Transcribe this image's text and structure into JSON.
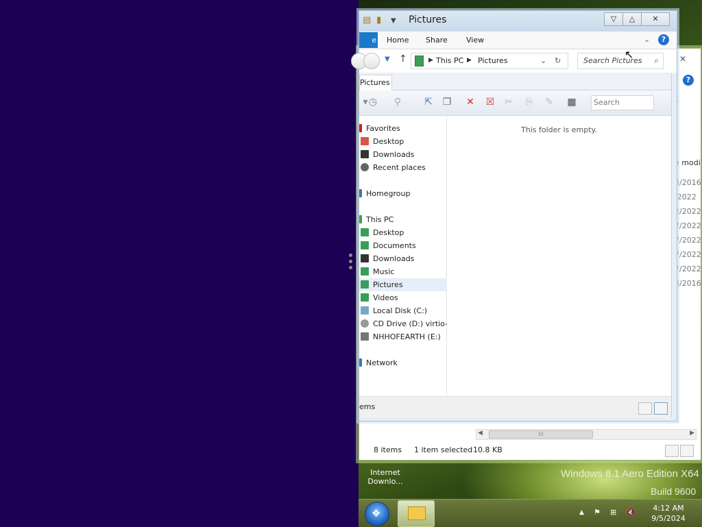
{
  "back_window": {
    "close_glyph": "✕",
    "help_glyph": "?",
    "column_header": "e modi",
    "dates": [
      "8/2016",
      "/2022",
      "2/2022",
      "7/2022",
      "7/2022",
      "7/2022",
      "7/2022",
      "8/2016"
    ],
    "status": {
      "count": "8 items",
      "selected": "1 item selected",
      "size": "10.8 KB"
    },
    "scroll_thumb_glyph": "⁞⁞⁞"
  },
  "window": {
    "title": "Pictures",
    "quick_access_icons": [
      "properties-icon",
      "new-folder-icon",
      "customize-dropdown-icon"
    ],
    "caption": {
      "minimize": "▽",
      "maximize": "△",
      "close": "✕"
    },
    "ribbon": {
      "file_tab": "e",
      "tabs": [
        "Home",
        "Share",
        "View"
      ],
      "help": "?"
    },
    "navigation": {
      "breadcrumb": [
        "This PC",
        "Pictures"
      ],
      "search_placeholder": "Search Pictures"
    },
    "tab_label": "Pictures",
    "toolbar_search_placeholder": "Search",
    "nav_pane": {
      "favorites_header": "Favorites",
      "favorites": [
        "Desktop",
        "Downloads",
        "Recent places"
      ],
      "homegroup": "Homegroup",
      "this_pc_header": "This PC",
      "this_pc": [
        "Desktop",
        "Documents",
        "Downloads",
        "Music",
        "Pictures",
        "Videos",
        "Local Disk (C:)",
        "CD Drive (D:) virtio-wi",
        "NHHOFEARTH (E:)"
      ],
      "network": "Network",
      "selected": "Pictures"
    },
    "empty_message": "This folder is empty.",
    "status_items": "ems"
  },
  "desktop": {
    "icon_label_line1": "Internet",
    "icon_label_line2": "Downlo...",
    "brand": "Windows 8.1 Aero Edition X64",
    "build": "Build 9600"
  },
  "taskbar": {
    "start_glyph": "❖",
    "tray": {
      "expand": "▲",
      "flag": "⚑",
      "network": "⊞",
      "volume": "🔇"
    },
    "time": "4:12 AM",
    "date": "9/5/2024"
  },
  "colors": {
    "accent": "#1979ca",
    "snap_background": "#1c0054"
  }
}
